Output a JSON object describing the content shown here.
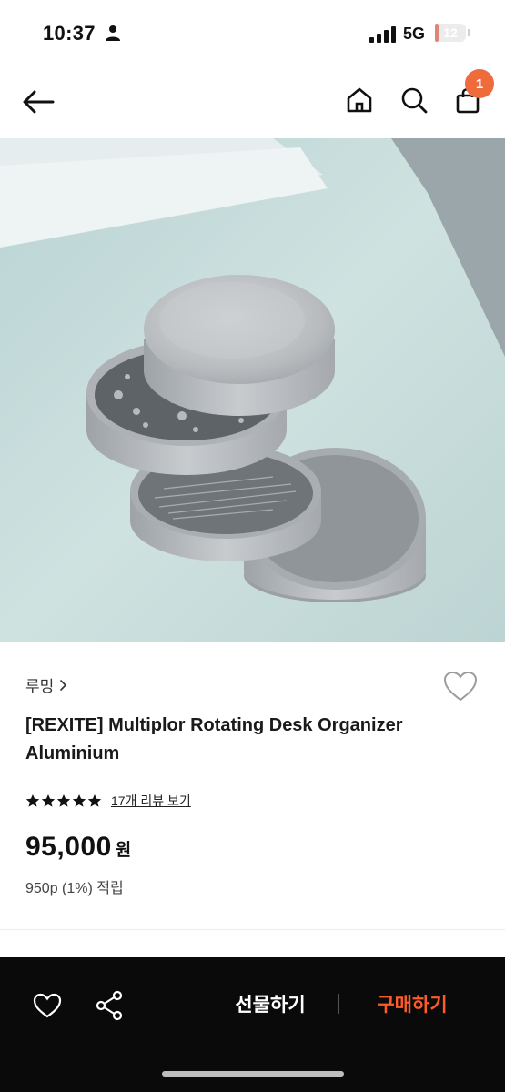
{
  "status_bar": {
    "time": "10:37",
    "network": "5G",
    "battery": "12",
    "battery_level": 0.12
  },
  "header": {
    "cart_badge": "1"
  },
  "product": {
    "brand": "루밍",
    "title": "[REXITE] Multiplor Rotating Desk Organizer Aluminium",
    "rating_stars": 5,
    "review_link": "17개 리뷰 보기",
    "price": "95,000",
    "currency": "원",
    "points": "950p (1%) 적립"
  },
  "bottom_bar": {
    "gift_label": "선물하기",
    "buy_label": "구매하기"
  },
  "colors": {
    "accent": "#ff5b2a",
    "badge": "#ef6b3c",
    "bottom_bar_bg": "#0a0a0a"
  },
  "icons": [
    "back-arrow-icon",
    "home-icon",
    "search-icon",
    "cart-icon",
    "chevron-right-icon",
    "heart-icon",
    "star-icon",
    "share-icon",
    "person-icon",
    "signal-icon"
  ]
}
